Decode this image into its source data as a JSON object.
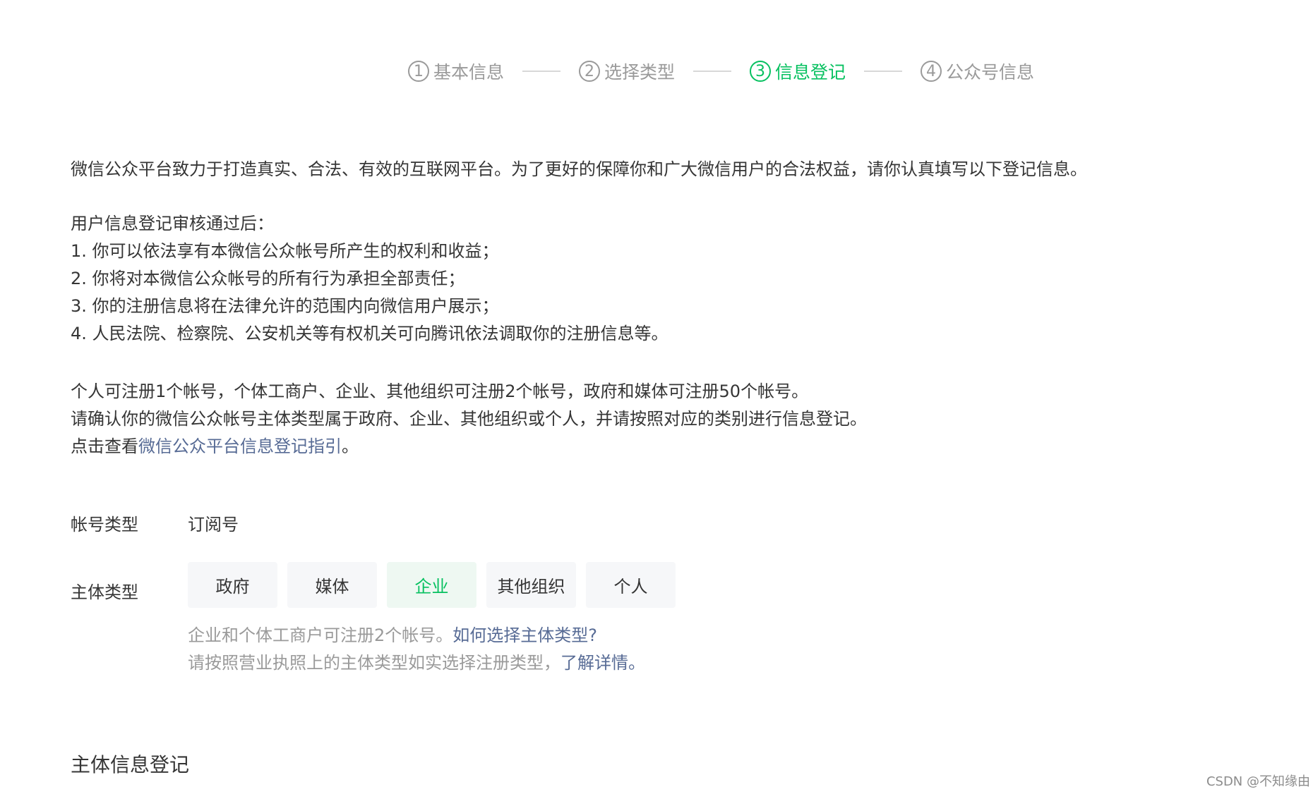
{
  "steps": [
    {
      "num": "1",
      "label": "基本信息"
    },
    {
      "num": "2",
      "label": "选择类型"
    },
    {
      "num": "3",
      "label": "信息登记"
    },
    {
      "num": "4",
      "label": "公众号信息"
    }
  ],
  "intro": "微信公众平台致力于打造真实、合法、有效的互联网平台。为了更好的保障你和广大微信用户的合法权益，请你认真填写以下登记信息。",
  "after_review": {
    "heading": "用户信息登记审核通过后：",
    "items": [
      "1. 你可以依法享有本微信公众帐号所产生的权利和收益；",
      "2. 你将对本微信公众帐号的所有行为承担全部责任；",
      "3. 你的注册信息将在法律允许的范围内向微信用户展示；",
      "4. 人民法院、检察院、公安机关等有权机关可向腾讯依法调取你的注册信息等。"
    ]
  },
  "limits": {
    "line1": "个人可注册1个帐号，个体工商户、企业、其他组织可注册2个帐号，政府和媒体可注册50个帐号。",
    "line2": "请确认你的微信公众帐号主体类型属于政府、企业、其他组织或个人，并请按照对应的类别进行信息登记。",
    "line3_prefix": "点击查看",
    "line3_link": "微信公众平台信息登记指引",
    "line3_suffix": "。"
  },
  "account_type": {
    "label": "帐号类型",
    "value": "订阅号"
  },
  "subject_type": {
    "label": "主体类型",
    "options": [
      "政府",
      "媒体",
      "企业",
      "其他组织",
      "个人"
    ],
    "selected": "企业",
    "tip1_text": "企业和个体工商户可注册2个帐号。",
    "tip1_link": "如何选择主体类型?",
    "tip2_text": "请按照营业执照上的主体类型如实选择注册类型，",
    "tip2_link": "了解详情。"
  },
  "section_title": "主体信息登记",
  "watermark": "CSDN @不知缘由",
  "colors": {
    "accent": "#07c160",
    "link": "#576b95",
    "muted": "#9a9a9a",
    "text": "#353535"
  }
}
